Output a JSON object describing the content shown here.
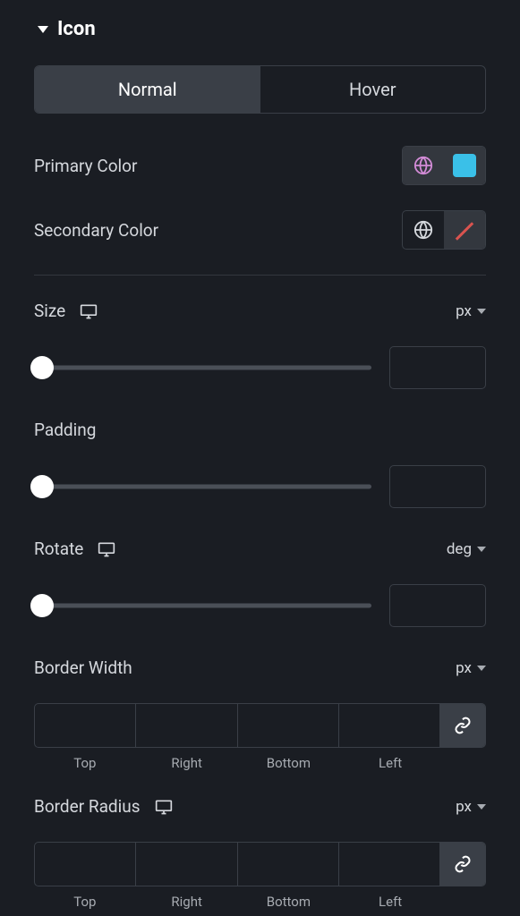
{
  "section": {
    "title": "Icon"
  },
  "tabs": {
    "normal": "Normal",
    "hover": "Hover",
    "active_index": 0
  },
  "primary_color": {
    "label": "Primary Color",
    "swatch": "#3ac0e8"
  },
  "secondary_color": {
    "label": "Secondary Color"
  },
  "size": {
    "label": "Size",
    "unit": "px",
    "value": ""
  },
  "padding": {
    "label": "Padding",
    "value": ""
  },
  "rotate": {
    "label": "Rotate",
    "unit": "deg",
    "value": ""
  },
  "border_width": {
    "label": "Border Width",
    "unit": "px",
    "sides": {
      "top": "Top",
      "right": "Right",
      "bottom": "Bottom",
      "left": "Left"
    },
    "values": {
      "top": "",
      "right": "",
      "bottom": "",
      "left": ""
    }
  },
  "border_radius": {
    "label": "Border Radius",
    "unit": "px",
    "sides": {
      "top": "Top",
      "right": "Right",
      "bottom": "Bottom",
      "left": "Left"
    },
    "values": {
      "top": "",
      "right": "",
      "bottom": "",
      "left": ""
    }
  }
}
